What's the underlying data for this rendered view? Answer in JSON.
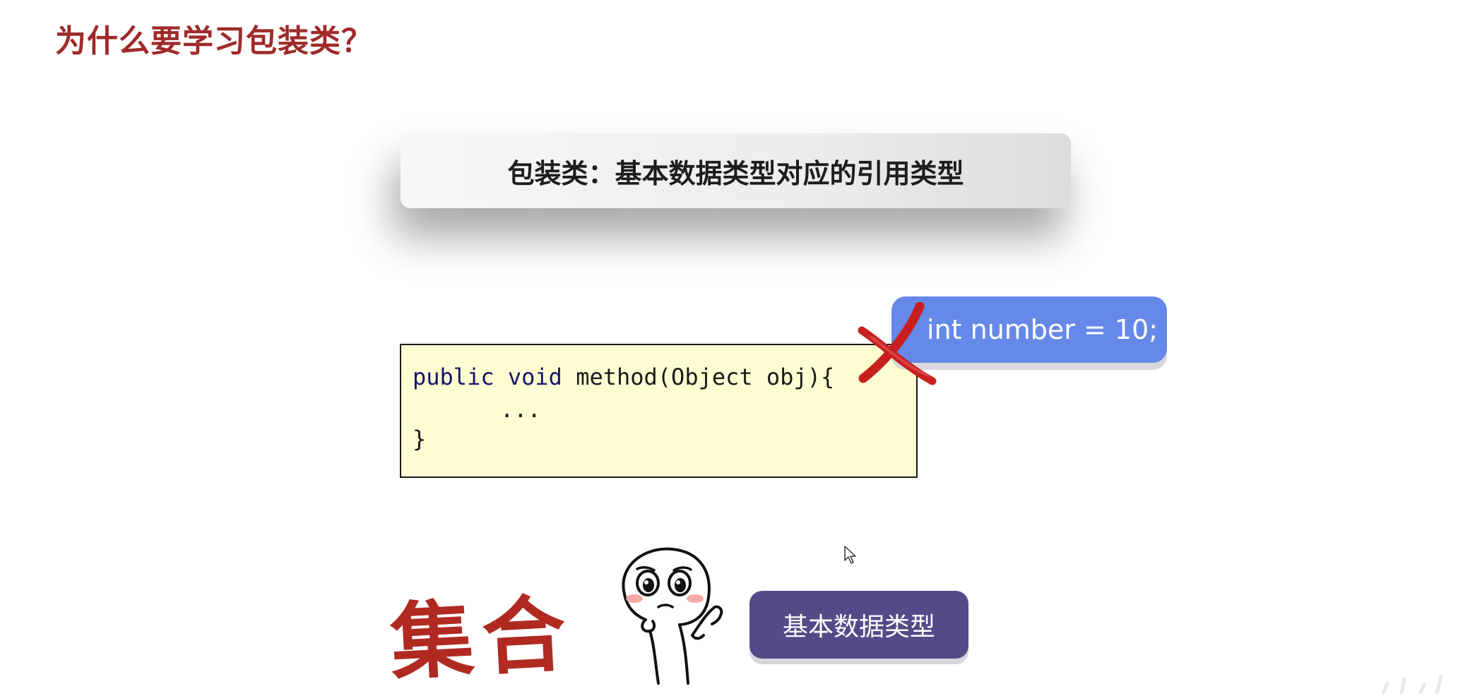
{
  "slide": {
    "title": "为什么要学习包装类？",
    "definition": "包装类：基本数据类型对应的引用类型"
  },
  "code": {
    "line1_kw1": "public",
    "line1_kw2": "void",
    "line1_rest": " method(Object obj){",
    "line2": "...",
    "line3": "}"
  },
  "bubble": {
    "int_code": "int number = 10;"
  },
  "bottom": {
    "collection_text": "集合",
    "primitive_button": "基本数据类型"
  },
  "colors": {
    "title": "#9e2a2a",
    "code_bg": "#fffed2",
    "bubble": "#6688e8",
    "button": "#534b88",
    "cross": "#c8201e"
  },
  "icons": {
    "cross": "x-cross-icon",
    "cursor": "mouse-cursor-icon",
    "character": "thinking-face-icon"
  }
}
